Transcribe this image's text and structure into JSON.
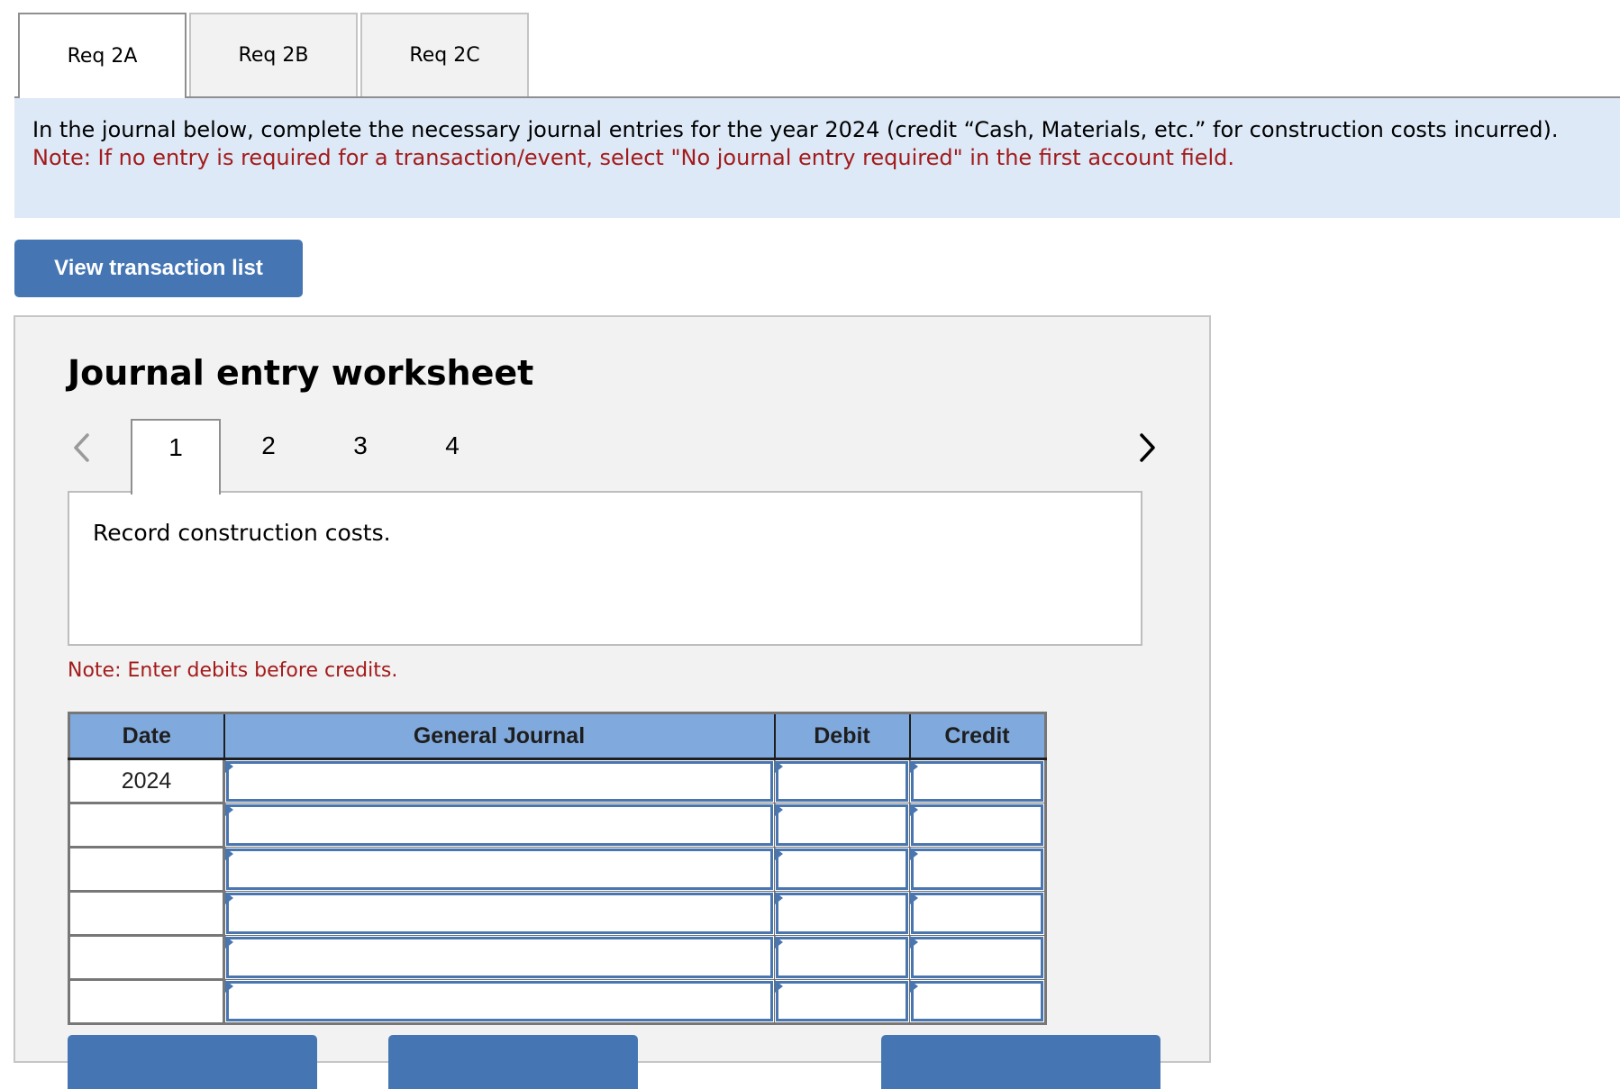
{
  "req_tabs": [
    {
      "label": "Req 2A",
      "active": true
    },
    {
      "label": "Req 2B",
      "active": false
    },
    {
      "label": "Req 2C",
      "active": false
    }
  ],
  "instructions": {
    "text": "In the journal below, complete the necessary journal entries for the year 2024 (credit “Cash, Materials, etc.” for construction costs incurred).",
    "note": "Note: If no entry is required for a transaction/event, select \"No journal entry required\" in the first account field."
  },
  "view_transaction_button": "View transaction list",
  "worksheet": {
    "title": "Journal entry worksheet",
    "prev_icon": "chevron-left-icon",
    "next_icon": "chevron-right-icon",
    "steps": [
      {
        "label": "1",
        "active": true
      },
      {
        "label": "2",
        "active": false
      },
      {
        "label": "3",
        "active": false
      },
      {
        "label": "4",
        "active": false
      }
    ],
    "description": "Record construction costs.",
    "debit_note": "Note: Enter debits before credits.",
    "table": {
      "headers": [
        "Date",
        "General Journal",
        "Debit",
        "Credit"
      ],
      "rows": [
        {
          "date": "2024",
          "account": "",
          "debit": "",
          "credit": ""
        },
        {
          "date": "",
          "account": "",
          "debit": "",
          "credit": ""
        },
        {
          "date": "",
          "account": "",
          "debit": "",
          "credit": ""
        },
        {
          "date": "",
          "account": "",
          "debit": "",
          "credit": ""
        },
        {
          "date": "",
          "account": "",
          "debit": "",
          "credit": ""
        },
        {
          "date": "",
          "account": "",
          "debit": "",
          "credit": ""
        }
      ]
    }
  },
  "colors": {
    "accent_button": "#4576b3",
    "header_fill": "#80aade",
    "input_border": "#4a76b0",
    "note_red": "#a31b1b",
    "instruction_bg": "#dde9f7",
    "panel_bg": "#f2f2f2"
  }
}
